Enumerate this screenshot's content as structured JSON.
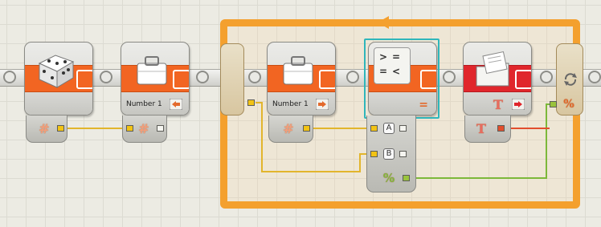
{
  "program": {
    "blocks": [
      {
        "id": "random",
        "icon": "dice-icon",
        "output_plug": "#"
      },
      {
        "id": "variable-read",
        "icon": "briefcase-icon",
        "label": "Number 1",
        "input_plug": "#"
      },
      {
        "id": "loop-start"
      },
      {
        "id": "variable-write",
        "icon": "briefcase-icon",
        "label": "Number 1",
        "output_plug": "#"
      },
      {
        "id": "compare",
        "icon": "compare-icon",
        "symbol_gt": ">",
        "symbol_eq1": "=",
        "symbol_eq2": "=",
        "symbol_lt": "<",
        "plug_a": "A",
        "plug_b": "B",
        "result_plug": "%",
        "mode_symbol": "="
      },
      {
        "id": "text-display",
        "icon": "folder-icon",
        "text_plug": "T",
        "input_plug": "T"
      },
      {
        "id": "loop-end",
        "icon": "loop-icon",
        "plug": "%"
      }
    ]
  },
  "colors": {
    "orange_band": "#f26522",
    "loop_frame": "#f4a02e",
    "selection": "#2fb6bb",
    "wire_number": "#e2b52c",
    "wire_logic": "#7cb83a",
    "wire_text": "#e24e2d",
    "text_block": "#e0262c"
  }
}
